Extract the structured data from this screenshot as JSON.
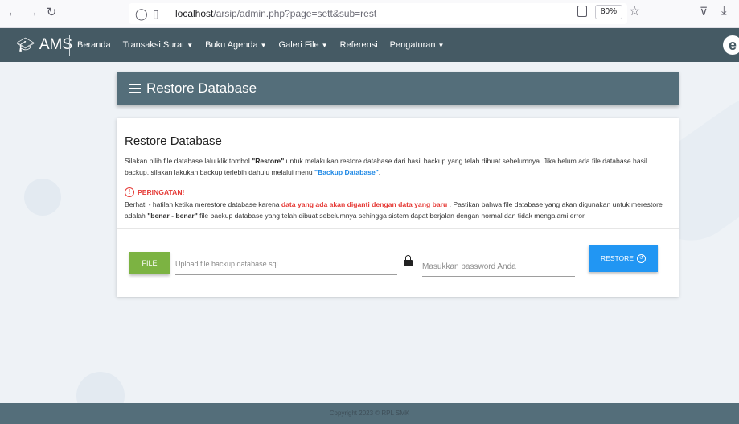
{
  "browser": {
    "url_host": "localhost",
    "url_path": "/arsip/admin.php?page=sett&sub=rest",
    "zoom": "80%"
  },
  "navbar": {
    "brand": "AMS",
    "menu": [
      {
        "label": "Beranda",
        "dropdown": false
      },
      {
        "label": "Transaksi Surat",
        "dropdown": true
      },
      {
        "label": "Buku Agenda",
        "dropdown": true
      },
      {
        "label": "Galeri File",
        "dropdown": true
      },
      {
        "label": "Referensi",
        "dropdown": false
      },
      {
        "label": "Pengaturan",
        "dropdown": true
      }
    ]
  },
  "header": {
    "title": "Restore Database"
  },
  "card": {
    "title": "Restore Database",
    "desc_1": "Silakan pilih file database lalu klik tombol ",
    "desc_bold": "\"Restore\"",
    "desc_2": " untuk melakukan restore database dari hasil backup yang telah dibuat sebelumnya. Jika belum ada file database hasil backup, silakan lakukan backup terlebih dahulu melalui menu ",
    "desc_link": "\"Backup Database\"",
    "desc_end": ".",
    "warning_title": "PERINGATAN!",
    "warning_1": "Berhati - hatilah ketika merestore database karena ",
    "warning_red": "data yang ada akan diganti dengan data yang baru",
    "warning_2": " . Pastikan bahwa file database yang akan digunakan untuk merestore adalah ",
    "warning_bold": "\"benar - benar\"",
    "warning_3": " file backup database yang telah dibuat sebelumnya sehingga sistem dapat berjalan dengan normal dan tidak mengalami error."
  },
  "form": {
    "file_button": "FILE",
    "file_placeholder": "Upload file backup database sql",
    "password_placeholder": "Masukkan password Anda",
    "restore_button": "RESTORE"
  },
  "footer": {
    "text": "Copyright 2023 © RPL SMK"
  },
  "colors": {
    "navbar": "#455a64",
    "header": "#546e7a",
    "file_button": "#7cb342",
    "restore_button": "#2196f3",
    "warning": "#e53935"
  }
}
